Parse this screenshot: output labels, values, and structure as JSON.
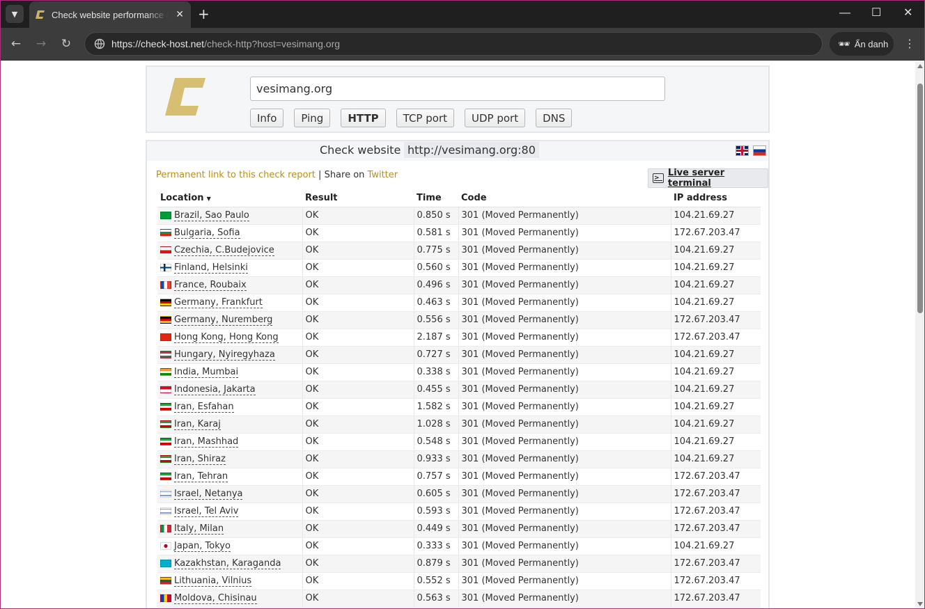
{
  "browser": {
    "tab_title": "Check website performance and",
    "url_host": "https://check-host.net",
    "url_path": "/check-http?host=vesimang.org",
    "incognito_label": "Ẩn danh"
  },
  "header": {
    "host_value": "vesimang.org",
    "buttons": [
      "Info",
      "Ping",
      "HTTP",
      "TCP port",
      "UDP port",
      "DNS"
    ],
    "active_button": "HTTP"
  },
  "result": {
    "title": "Check website",
    "target": "http://vesimang.org:80",
    "permalink_label": "Permanent link to this check report",
    "separator": "|",
    "share_label": "Share on",
    "twitter_label": "Twitter",
    "terminal_label": "Live server terminal",
    "columns": [
      "Location",
      "Result",
      "Time",
      "Code",
      "IP address"
    ],
    "rows": [
      {
        "location": "Brazil, Sao Paulo",
        "result": "OK",
        "time": "0.850 s",
        "code": "301 (Moved Permanently)",
        "ip": "104.21.69.27"
      },
      {
        "location": "Bulgaria, Sofia",
        "result": "OK",
        "time": "0.581 s",
        "code": "301 (Moved Permanently)",
        "ip": "172.67.203.47"
      },
      {
        "location": "Czechia, C.Budejovice",
        "result": "OK",
        "time": "0.775 s",
        "code": "301 (Moved Permanently)",
        "ip": "104.21.69.27"
      },
      {
        "location": "Finland, Helsinki",
        "result": "OK",
        "time": "0.560 s",
        "code": "301 (Moved Permanently)",
        "ip": "104.21.69.27"
      },
      {
        "location": "France, Roubaix",
        "result": "OK",
        "time": "0.496 s",
        "code": "301 (Moved Permanently)",
        "ip": "104.21.69.27"
      },
      {
        "location": "Germany, Frankfurt",
        "result": "OK",
        "time": "0.463 s",
        "code": "301 (Moved Permanently)",
        "ip": "104.21.69.27"
      },
      {
        "location": "Germany, Nuremberg",
        "result": "OK",
        "time": "0.556 s",
        "code": "301 (Moved Permanently)",
        "ip": "172.67.203.47"
      },
      {
        "location": "Hong Kong, Hong Kong",
        "result": "OK",
        "time": "2.187 s",
        "code": "301 (Moved Permanently)",
        "ip": "172.67.203.47"
      },
      {
        "location": "Hungary, Nyiregyhaza",
        "result": "OK",
        "time": "0.727 s",
        "code": "301 (Moved Permanently)",
        "ip": "104.21.69.27"
      },
      {
        "location": "India, Mumbai",
        "result": "OK",
        "time": "0.338 s",
        "code": "301 (Moved Permanently)",
        "ip": "104.21.69.27"
      },
      {
        "location": "Indonesia, Jakarta",
        "result": "OK",
        "time": "0.455 s",
        "code": "301 (Moved Permanently)",
        "ip": "104.21.69.27"
      },
      {
        "location": "Iran, Esfahan",
        "result": "OK",
        "time": "1.582 s",
        "code": "301 (Moved Permanently)",
        "ip": "104.21.69.27"
      },
      {
        "location": "Iran, Karaj",
        "result": "OK",
        "time": "1.028 s",
        "code": "301 (Moved Permanently)",
        "ip": "104.21.69.27"
      },
      {
        "location": "Iran, Mashhad",
        "result": "OK",
        "time": "0.548 s",
        "code": "301 (Moved Permanently)",
        "ip": "104.21.69.27"
      },
      {
        "location": "Iran, Shiraz",
        "result": "OK",
        "time": "0.933 s",
        "code": "301 (Moved Permanently)",
        "ip": "104.21.69.27"
      },
      {
        "location": "Iran, Tehran",
        "result": "OK",
        "time": "0.757 s",
        "code": "301 (Moved Permanently)",
        "ip": "172.67.203.47"
      },
      {
        "location": "Israel, Netanya",
        "result": "OK",
        "time": "0.605 s",
        "code": "301 (Moved Permanently)",
        "ip": "172.67.203.47"
      },
      {
        "location": "Israel, Tel Aviv",
        "result": "OK",
        "time": "0.593 s",
        "code": "301 (Moved Permanently)",
        "ip": "172.67.203.47"
      },
      {
        "location": "Italy, Milan",
        "result": "OK",
        "time": "0.449 s",
        "code": "301 (Moved Permanently)",
        "ip": "172.67.203.47"
      },
      {
        "location": "Japan, Tokyo",
        "result": "OK",
        "time": "0.333 s",
        "code": "301 (Moved Permanently)",
        "ip": "104.21.69.27"
      },
      {
        "location": "Kazakhstan, Karaganda",
        "result": "OK",
        "time": "0.879 s",
        "code": "301 (Moved Permanently)",
        "ip": "172.67.203.47"
      },
      {
        "location": "Lithuania, Vilnius",
        "result": "OK",
        "time": "0.552 s",
        "code": "301 (Moved Permanently)",
        "ip": "172.67.203.47"
      },
      {
        "location": "Moldova, Chisinau",
        "result": "OK",
        "time": "0.563 s",
        "code": "301 (Moved Permanently)",
        "ip": "172.67.203.47"
      }
    ]
  },
  "flags": {
    "Brazil": "linear-gradient(#009b3a,#009b3a)",
    "Bulgaria": "linear-gradient(#fff 33%,#00966e 33%,#00966e 66%,#d62612 66%)",
    "Czechia": "linear-gradient(to bottom,#fff 50%,#d7141a 50%)",
    "Finland": "linear-gradient(to right,transparent 30%,#003580 30%,#003580 45%,transparent 45%),linear-gradient(#fff 40%,#003580 40%,#003580 60%,#fff 60%)",
    "France": "linear-gradient(to right,#0055a4 33%,#fff 33%,#fff 66%,#ef4135 66%)",
    "Germany": "linear-gradient(#000 33%,#dd0000 33%,#dd0000 66%,#ffce00 66%)",
    "Hong Kong": "linear-gradient(#de2910,#de2910)",
    "Hungary": "linear-gradient(#cd2a3e 33%,#fff 33%,#fff 66%,#436f4d 66%)",
    "India": "linear-gradient(#ff9933 33%,#fff 33%,#fff 66%,#138808 66%)",
    "Indonesia": "linear-gradient(#ce1126 50%,#fff 50%)",
    "Iran": "linear-gradient(#239f40 33%,#fff 33%,#fff 66%,#da0000 66%)",
    "Israel": "linear-gradient(#fff 15%,#0038b8 15%,#0038b8 25%,#fff 25%,#fff 75%,#0038b8 75%,#0038b8 85%,#fff 85%)",
    "Italy": "linear-gradient(to right,#009246 33%,#fff 33%,#fff 66%,#ce2b37 66%)",
    "Japan": "radial-gradient(circle,#bc002d 30%,#fff 32%)",
    "Kazakhstan": "linear-gradient(#00afca,#00afca)",
    "Lithuania": "linear-gradient(#fdb913 33%,#006a44 33%,#006a44 66%,#c1272d 66%)",
    "Moldova": "linear-gradient(to right,#0046ae 33%,#ffd200 33%,#ffd200 66%,#cc092f 66%)"
  }
}
